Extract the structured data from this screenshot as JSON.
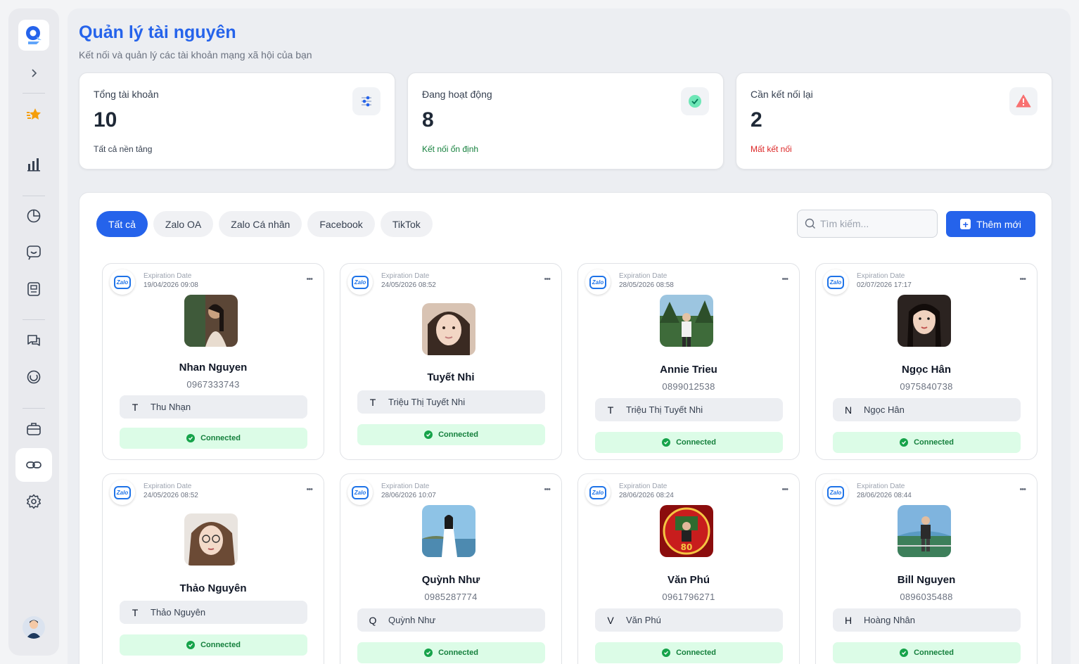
{
  "header": {
    "title": "Quản lý tài nguyên",
    "subtitle": "Kết nối và quản lý các tài khoản mạng xã hội của bạn"
  },
  "stats": [
    {
      "label": "Tổng tài khoản",
      "value": "10",
      "note": "Tất cả nền tảng",
      "icon": "sliders-icon",
      "note_color": "#374151"
    },
    {
      "label": "Đang hoạt động",
      "value": "8",
      "note": "Kết nối ổn định",
      "icon": "check-circle-icon",
      "note_color": "#15803d"
    },
    {
      "label": "Cần kết nối lại",
      "value": "2",
      "note": "Mất kết nối",
      "icon": "warning-icon",
      "note_color": "#dc2626"
    }
  ],
  "tabs": [
    "Tất cả",
    "Zalo OA",
    "Zalo Cá nhân",
    "Facebook",
    "TikTok"
  ],
  "search": {
    "placeholder": "Tìm kiếm..."
  },
  "add_button": "Thêm mới",
  "platform_badge": "Zalo",
  "expiration_label": "Expiration Date",
  "accounts": [
    {
      "date": "19/04/2026 09:08",
      "name": "Nhan Nguyen",
      "phone": "0967333743",
      "initial": "T",
      "owner": "Thu Nhạn",
      "status": "Connected"
    },
    {
      "date": "24/05/2026 08:52",
      "name": "Tuyết Nhi",
      "phone": "",
      "initial": "T",
      "owner": "Triệu Thị Tuyết Nhi",
      "status": "Connected"
    },
    {
      "date": "28/05/2026 08:58",
      "name": "Annie Trieu",
      "phone": "0899012538",
      "initial": "T",
      "owner": "Triệu Thị Tuyết Nhi",
      "status": "Connected"
    },
    {
      "date": "02/07/2026 17:17",
      "name": "Ngọc Hân",
      "phone": "0975840738",
      "initial": "N",
      "owner": "Ngọc Hân",
      "status": "Connected"
    },
    {
      "date": "24/05/2026 08:52",
      "name": "Thảo Nguyên",
      "phone": "",
      "initial": "T",
      "owner": "Thảo Nguyên",
      "status": "Connected"
    },
    {
      "date": "28/06/2026 10:07",
      "name": "Quỳnh Như",
      "phone": "0985287774",
      "initial": "Q",
      "owner": "Quỳnh Như",
      "status": "Connected"
    },
    {
      "date": "28/06/2026 08:24",
      "name": "Văn Phú",
      "phone": "0961796271",
      "initial": "V",
      "owner": "Văn Phú",
      "status": "Connected"
    },
    {
      "date": "28/06/2026 08:44",
      "name": "Bill Nguyen",
      "phone": "0896035488",
      "initial": "H",
      "owner": "Hoàng Nhân",
      "status": "Connected"
    }
  ],
  "colors": {
    "accent": "#2563eb",
    "success": "#15803d",
    "danger": "#dc2626"
  }
}
